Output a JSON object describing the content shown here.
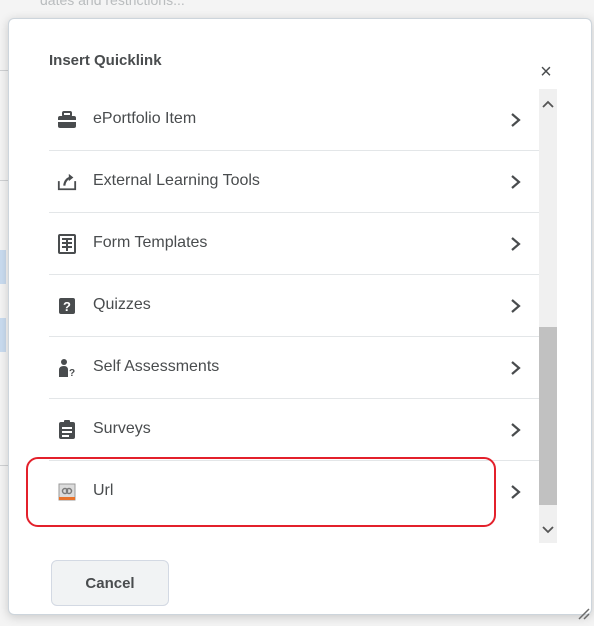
{
  "dialog": {
    "title": "Insert Quicklink",
    "close_label": "×",
    "cancel_label": "Cancel"
  },
  "background": {
    "top_text": "dates and restrictions..."
  },
  "items": [
    {
      "label": "ePortfolio Item",
      "icon": "briefcase-icon"
    },
    {
      "label": "External Learning Tools",
      "icon": "external-tool-icon"
    },
    {
      "label": "Form Templates",
      "icon": "form-template-icon"
    },
    {
      "label": "Quizzes",
      "icon": "quiz-icon"
    },
    {
      "label": "Self Assessments",
      "icon": "self-assessment-icon"
    },
    {
      "label": "Surveys",
      "icon": "survey-icon"
    },
    {
      "label": "Url",
      "icon": "url-icon"
    }
  ],
  "colors": {
    "highlight": "#e3202b",
    "text": "#494c4e",
    "scroll_thumb": "#c1c1c1"
  }
}
